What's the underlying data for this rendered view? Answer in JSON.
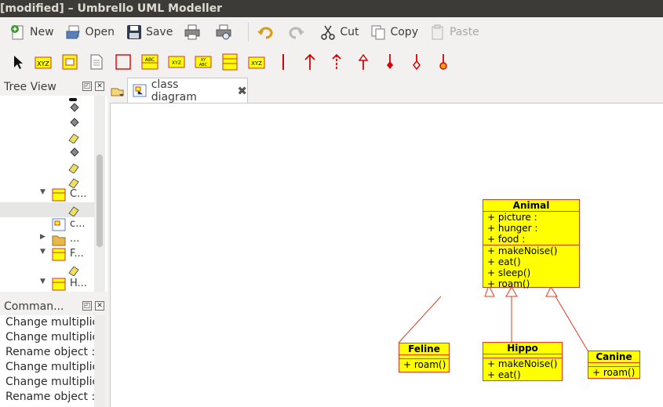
{
  "window": {
    "title": "[modified] – Umbrello UML Modeller"
  },
  "toolbar": {
    "new_label": "New",
    "open_label": "Open",
    "save_label": "Save",
    "cut_label": "Cut",
    "copy_label": "Copy",
    "paste_label": "Paste"
  },
  "tree_view": {
    "title": "Tree View",
    "items": [
      {
        "label": "C..."
      },
      {
        "label": "c..."
      },
      {
        "label": "..."
      },
      {
        "label": "F..."
      },
      {
        "label": "H..."
      }
    ]
  },
  "command_history": {
    "title": "Comman...",
    "items": [
      "Change multiplic",
      "Change multiplic",
      "Rename object :",
      "Change multiplic",
      "Change multiplic",
      "Rename object :"
    ]
  },
  "diagram_tab": {
    "label": "class diagram"
  },
  "diagram": {
    "classes": [
      {
        "name": "Animal",
        "attributes": [
          "+ picture :",
          "+ hunger :",
          "+ food :"
        ],
        "operations": [
          "+ makeNoise()",
          "+ eat()",
          "+ sleep()",
          "+ roam()"
        ]
      },
      {
        "name": "Feline",
        "attributes": [],
        "operations": [
          "+ roam()"
        ]
      },
      {
        "name": "Hippo",
        "attributes": [],
        "operations": [
          "+ makeNoise()",
          "+ eat()"
        ]
      },
      {
        "name": "Canine",
        "attributes": [],
        "operations": [
          "+ roam()"
        ]
      }
    ]
  },
  "colors": {
    "class_fill": "#ffff00",
    "class_border": "#e23a1c",
    "title_bar": "#3c3b37",
    "arrow_red": "#e00000"
  }
}
